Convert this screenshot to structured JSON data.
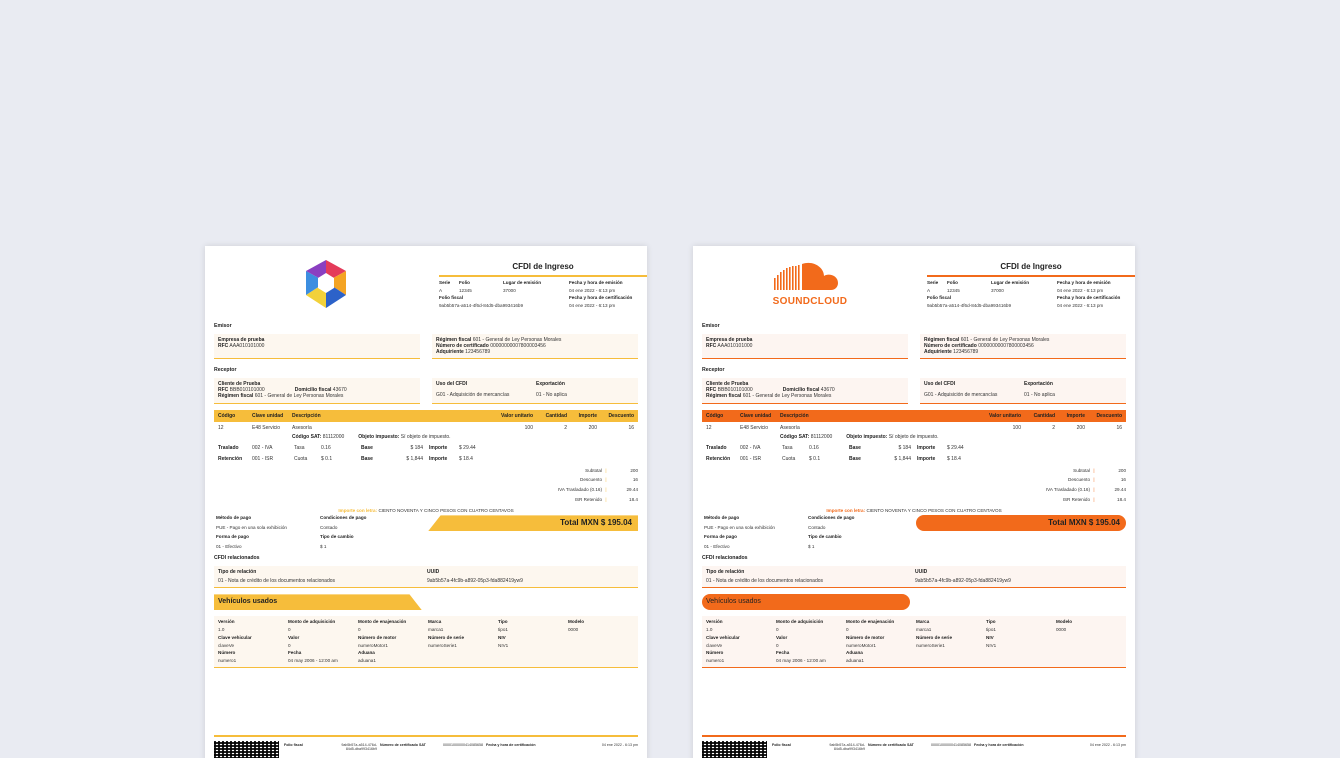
{
  "docs": [
    {
      "title": "CFDI de Ingreso",
      "header": {
        "serie_label": "Serie",
        "serie": "A",
        "folio_label": "Folio",
        "folio": "12345",
        "lugar_label": "Lugar de emisión",
        "lugar": "37000",
        "fecha_emision_label": "Fecha y hora de emisión",
        "fecha_emision": "04 ene 2022 - 6:13 pm",
        "folio_fiscal_label": "Folio fiscal",
        "folio_fiscal": "9ab5b57a-a514-4f6d-84d5-dba993416b9",
        "fecha_cert_label": "Fecha y hora de certificación",
        "fecha_cert": "04 ene 2022 - 6:13 pm"
      },
      "emisor": {
        "section": "Emisor",
        "nombre": "Empresa de prueba",
        "rfc_label": "RFC",
        "rfc": "AAA010101000",
        "regimen_label": "Régimen fiscal",
        "regimen": "601 - General de Ley Personas Morales",
        "cert_label": "Número de certificado",
        "cert": "00000000007800003456",
        "adquiriente_label": "Adquiriente",
        "adquiriente": "123456789"
      },
      "receptor": {
        "section": "Receptor",
        "nombre": "Cliente de Prueba",
        "rfc_label": "RFC",
        "rfc": "BBB010101000",
        "domicilio_label": "Domicilio fiscal",
        "domicilio": "43670",
        "regimen_label": "Régimen fiscal",
        "regimen": "601 - General de Ley Personas Morales",
        "uso_label": "Uso del CFDI",
        "uso": "G01 - Adquisición de mercancías",
        "exportacion_label": "Exportación",
        "exportacion": "01 - No aplica"
      },
      "table": {
        "headers": [
          "Código",
          "Clave unidad",
          "Descripción",
          "Valor unitario",
          "Cantidad",
          "Importe",
          "Descuento"
        ],
        "row": [
          "12",
          "E48 Servicio",
          "Asesoría",
          "100",
          "2",
          "200",
          "16"
        ],
        "sat_label": "Código SAT:",
        "sat": "81112000",
        "objeto_label": "Objeto impuesto:",
        "objeto": "Sí objeto de impuesto.",
        "traslado": {
          "label": "Traslado",
          "code": "002 - IVA",
          "tipo": "Tasa",
          "tasa": "0.16",
          "base_label": "Base",
          "base": "$ 184",
          "importe_label": "Importe",
          "importe": "$ 29.44"
        },
        "retencion": {
          "label": "Retención",
          "code": "001 - ISR",
          "tipo": "Cuota",
          "tasa": "$ 0.1",
          "base_label": "Base",
          "base": "$ 1,844",
          "importe_label": "Importe",
          "importe": "$ 18.4"
        }
      },
      "totals": [
        {
          "label": "Subtotal",
          "value": "200"
        },
        {
          "label": "Descuento",
          "value": "16"
        },
        {
          "label": "IVA Trasladado (0.16)",
          "value": "29.44"
        },
        {
          "label": "ISR Retenido",
          "value": "18.4"
        }
      ],
      "letras_label": "Importe con letra:",
      "letras": "CIENTO NOVENTA Y CINCO PESOS CON CUATRO CENTAVOS",
      "pago": {
        "metodo_label": "Método de pago",
        "metodo": "PUE - Pago en una sola exhibición",
        "condiciones_label": "Condiciones de pago",
        "condiciones": "Contado",
        "forma_label": "Forma de pago",
        "forma": "01 - Efectivo",
        "tipo_cambio_label": "Tipo de cambio",
        "tipo_cambio": "$ 1"
      },
      "total": "Total MXN $ 195.04",
      "relacionados": {
        "section": "CFDI relacionados",
        "tipo_label": "Tipo de relación",
        "tipo": "01 - Nota de crédito de los documentos relacionados",
        "uuid_label": "UUID",
        "uuid": "9ab5b57a-4fc9b-a892-05p3-fda882419yw9"
      },
      "vehiculos": {
        "title": "Vehículos usados",
        "fields": [
          [
            "Versión",
            "1.0"
          ],
          [
            "Monto de adquisición",
            "0"
          ],
          [
            "Monto de enajenación",
            "0"
          ],
          [
            "Marca",
            "marca1"
          ],
          [
            "Tipo",
            "tipo1"
          ],
          [
            "Modelo",
            "0000"
          ],
          [
            "Clave vehicular",
            "claveVe"
          ],
          [
            "Valor",
            "0"
          ],
          [
            "Número de motor",
            "numeroMotor1"
          ],
          [
            "Número de serie",
            "numeroSerie1"
          ],
          [
            "NIV",
            "NIV1"
          ],
          [
            "",
            ""
          ],
          [
            "Número",
            "numero1"
          ],
          [
            "Fecha",
            "04 may 2006 - 12:00 am"
          ],
          [
            "Aduana",
            "aduana1"
          ]
        ]
      },
      "footer": [
        "Folio fiscal",
        "9ab5b57a-a514-476d-84d5-dba993416b9",
        "Número de certificado SAT",
        "00001000000414085658",
        "Fecha y hora de certificación",
        "04 ene 2022 - 6:13 pm"
      ]
    }
  ],
  "logos": {
    "left": "hexagon-logo",
    "right_text": "SOUNDCLOUD"
  },
  "colors": {
    "left_accent": "#f6bd3b",
    "right_accent": "#f26a1b"
  }
}
